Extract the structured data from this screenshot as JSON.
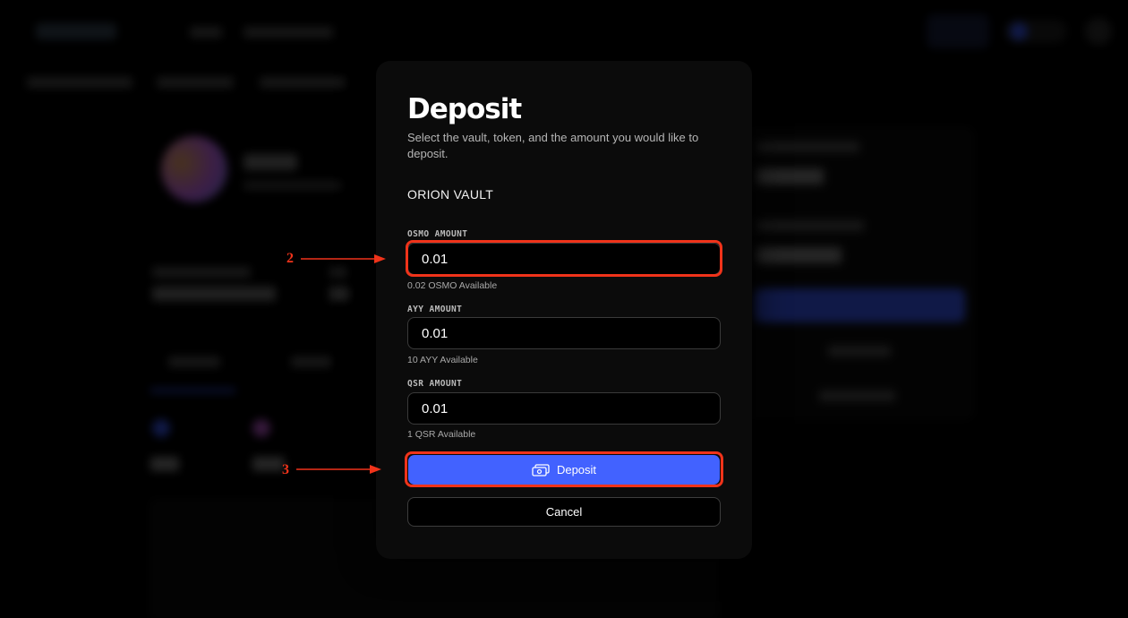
{
  "modal": {
    "title": "Deposit",
    "subtitle": "Select the vault, token, and the amount you would like to deposit.",
    "vault_name": "ORION VAULT",
    "fields": [
      {
        "label": "OSMO AMOUNT",
        "value": "0.01",
        "available": "0.02 OSMO Available"
      },
      {
        "label": "AYY AMOUNT",
        "value": "0.01",
        "available": "10 AYY Available"
      },
      {
        "label": "QSR AMOUNT",
        "value": "0.01",
        "available": "1 QSR Available"
      }
    ],
    "deposit_label": "Deposit",
    "cancel_label": "Cancel"
  },
  "annotations": {
    "step_osmo": "2",
    "step_deposit": "3",
    "color": "#f0331a"
  },
  "colors": {
    "accent": "#4262ff",
    "background": "#000000",
    "modal": "#0b0b0b"
  }
}
